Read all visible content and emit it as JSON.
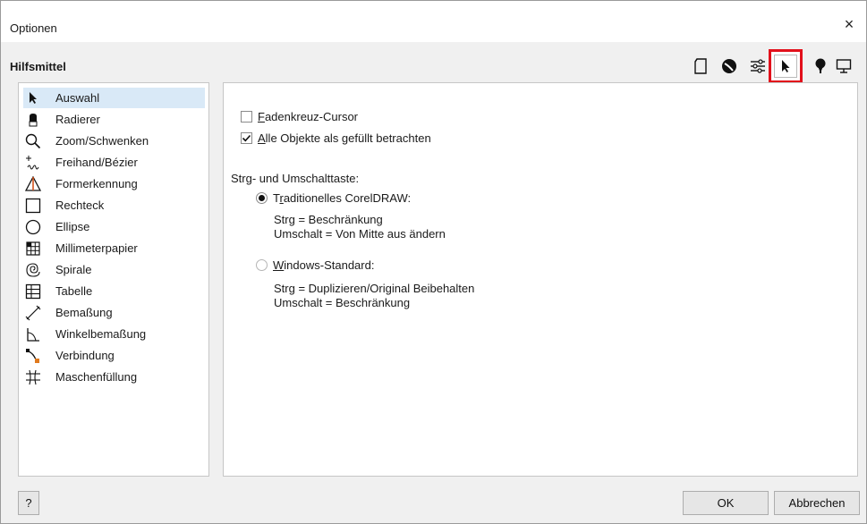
{
  "window": {
    "title": "Optionen",
    "close_glyph": "×"
  },
  "section_title": "Hilfsmittel",
  "toolbar": {
    "buttons": [
      {
        "name": "page-icon"
      },
      {
        "name": "globe-icon"
      },
      {
        "name": "sliders-icon"
      },
      {
        "name": "pointer-icon",
        "active": true
      },
      {
        "name": "lightbulb-icon"
      },
      {
        "name": "monitor-icon"
      }
    ],
    "active_border_color": "#e2101b"
  },
  "tools": [
    {
      "label": "Auswahl",
      "icon": "pointer-icon",
      "selected": true
    },
    {
      "label": "Radierer",
      "icon": "eraser-icon"
    },
    {
      "label": "Zoom/Schwenken",
      "icon": "zoom-icon"
    },
    {
      "label": "Freihand/Bézier",
      "icon": "freehand-icon"
    },
    {
      "label": "Formerkennung",
      "icon": "shape-recognition-icon"
    },
    {
      "label": "Rechteck",
      "icon": "rectangle-icon"
    },
    {
      "label": "Ellipse",
      "icon": "ellipse-icon"
    },
    {
      "label": "Millimeterpapier",
      "icon": "graph-paper-icon"
    },
    {
      "label": "Spirale",
      "icon": "spiral-icon"
    },
    {
      "label": "Tabelle",
      "icon": "table-icon"
    },
    {
      "label": "Bemaßung",
      "icon": "dimension-icon"
    },
    {
      "label": "Winkelbemaßung",
      "icon": "angular-dimension-icon"
    },
    {
      "label": "Verbindung",
      "icon": "connector-icon"
    },
    {
      "label": "Maschenfüllung",
      "icon": "mesh-fill-icon"
    }
  ],
  "options": {
    "crosshair": {
      "underline_char": "F",
      "rest": "adenkreuz-Cursor",
      "checked": false
    },
    "treat_filled": {
      "underline_char": "A",
      "rest": "lle Objekte als gefüllt betrachten",
      "checked": true
    },
    "modifier_heading": "Strg- und Umschalttaste:",
    "traditional": {
      "prefix": "T",
      "underline_char": "r",
      "rest": "aditionelles CorelDRAW:",
      "selected": true,
      "line1": "Strg = Beschränkung",
      "line2": "Umschalt = Von Mitte aus ändern"
    },
    "windows": {
      "underline_char": "W",
      "rest": "indows-Standard:",
      "selected": false,
      "line1": "Strg = Duplizieren/Original Beibehalten",
      "line2": "Umschalt = Beschränkung"
    }
  },
  "buttons": {
    "help": "?",
    "ok": "OK",
    "cancel": "Abbrechen"
  }
}
